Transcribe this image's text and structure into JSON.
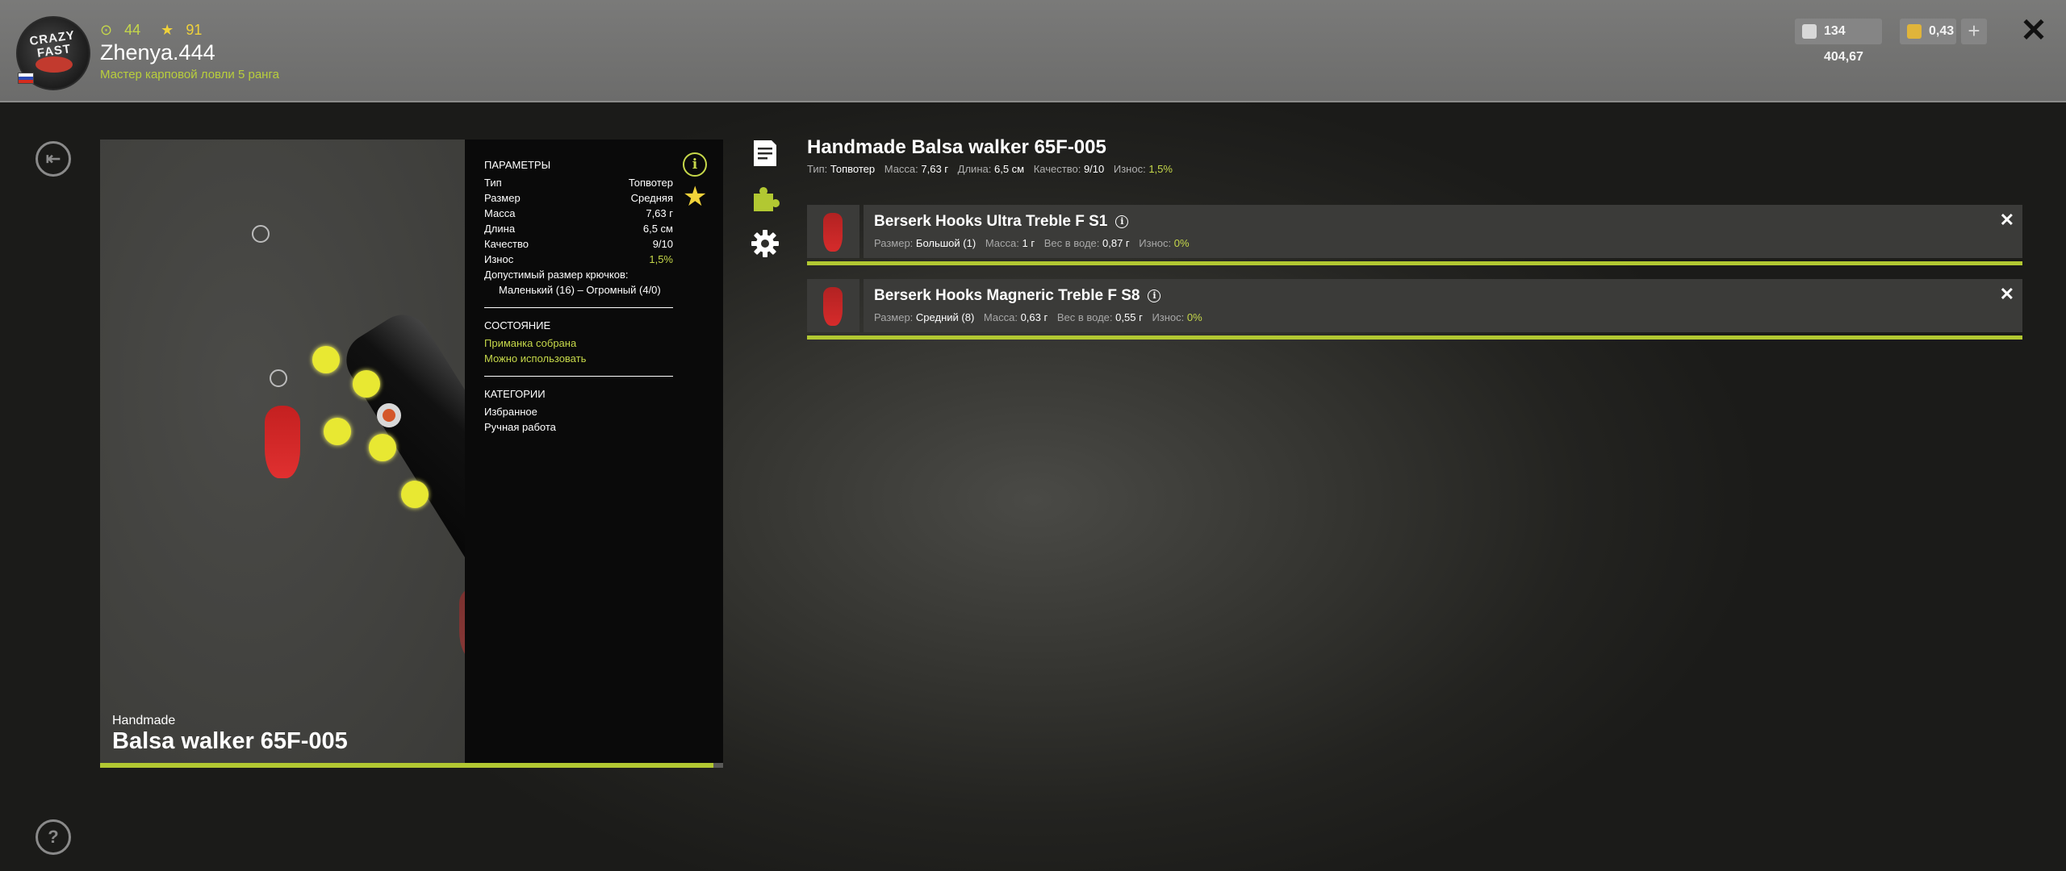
{
  "player": {
    "avatar_text": "CRAZY FAST",
    "level": "44",
    "stars": "91",
    "name": "Zhenya.444",
    "rank_title": "Мастер карповой ловли 5 ранга"
  },
  "currency": {
    "silver": "134 404,67",
    "gold": "0,43",
    "add_label": "+"
  },
  "lure": {
    "brand": "Handmade",
    "name": "Balsa walker 65F-005",
    "progress_fraction": 0.985,
    "params": {
      "title": "ПАРАМЕТРЫ",
      "rows": [
        {
          "label": "Тип",
          "value": "Топвотер"
        },
        {
          "label": "Размер",
          "value": "Средняя"
        },
        {
          "label": "Масса",
          "value": "7,63 г"
        },
        {
          "label": "Длина",
          "value": "6,5 см"
        },
        {
          "label": "Качество",
          "value": "9/10"
        },
        {
          "label": "Износ",
          "value": "1,5%"
        }
      ],
      "hooks_label": "Допустимый размер крючков:",
      "hooks_value": "Маленький (16) – Огромный (4/0)"
    },
    "state": {
      "title": "СОСТОЯНИЕ",
      "lines": [
        "Приманка собрана",
        "Можно использовать"
      ]
    },
    "categories": {
      "title": "КАТЕГОРИИ",
      "items": [
        "Избранное",
        "Ручная работа"
      ]
    }
  },
  "detail": {
    "title": "Handmade Balsa walker 65F-005",
    "stats": [
      {
        "label": "Тип:",
        "value": "Топвотер"
      },
      {
        "label": "Масса:",
        "value": "7,63 г"
      },
      {
        "label": "Длина:",
        "value": "6,5 см"
      },
      {
        "label": "Качество:",
        "value": "9/10"
      },
      {
        "label": "Износ:",
        "value": "1,5%"
      }
    ]
  },
  "hooks": [
    {
      "name": "Berserk Hooks Ultra Treble F S1",
      "stats": [
        {
          "label": "Размер:",
          "value": "Большой (1)"
        },
        {
          "label": "Масса:",
          "value": "1 г"
        },
        {
          "label": "Вес в воде:",
          "value": "0,87 г"
        },
        {
          "label": "Износ:",
          "value": "0%"
        }
      ],
      "wear_fraction": 1.0
    },
    {
      "name": "Berserk Hooks Magneric Treble F S8",
      "stats": [
        {
          "label": "Размер:",
          "value": "Средний (8)"
        },
        {
          "label": "Масса:",
          "value": "0,63 г"
        },
        {
          "label": "Вес в воде:",
          "value": "0,55 г"
        },
        {
          "label": "Износ:",
          "value": "0%"
        }
      ],
      "wear_fraction": 1.0
    }
  ],
  "icons": {
    "back": "back-arrow-icon",
    "help": "question-icon",
    "description": "document-icon",
    "components": "puzzle-icon",
    "settings": "gear-icon",
    "info": "info-icon",
    "favorite": "star-icon",
    "close": "close-icon"
  },
  "colors": {
    "accent_green": "#c6d84a",
    "progress_green": "#b2c832",
    "star_yellow": "#f0d23a"
  }
}
